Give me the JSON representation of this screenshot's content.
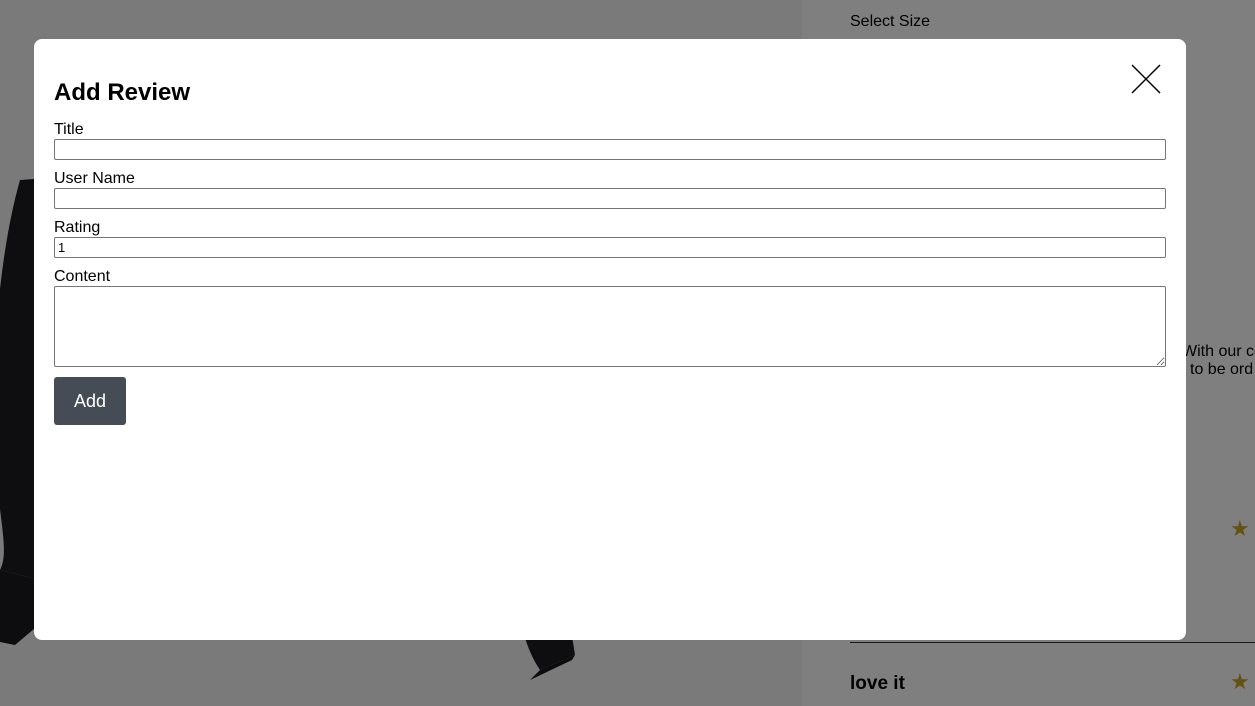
{
  "background": {
    "select_size_label": "Select Size",
    "description_line1": "With our co",
    "description_line2": "to be ord",
    "review_title": "love it",
    "rating_icon": "star-icon",
    "rating_color": "#c9a227"
  },
  "modal": {
    "title": "Add Review",
    "close_icon": "close-icon",
    "fields": {
      "title_label": "Title",
      "title_value": "",
      "username_label": "User Name",
      "username_value": "",
      "rating_label": "Rating",
      "rating_value": "1",
      "content_label": "Content",
      "content_value": ""
    },
    "add_button_label": "Add",
    "add_button_color": "#454c55"
  }
}
